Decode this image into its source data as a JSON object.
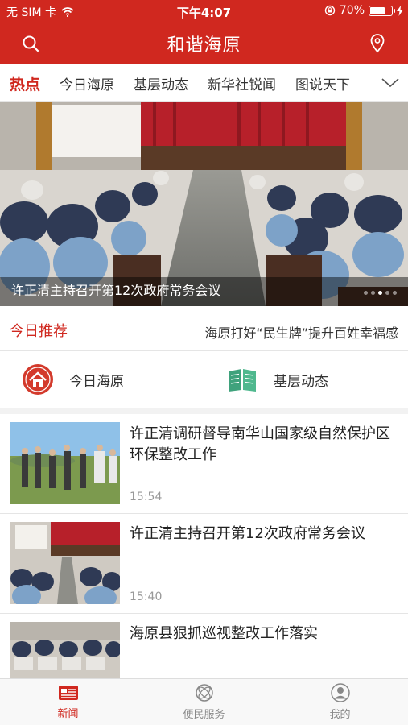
{
  "status_bar": {
    "carrier": "无 SIM 卡",
    "time": "下午4:07",
    "battery": "70%",
    "battery_level": 0.7
  },
  "nav": {
    "title": "和谐海原"
  },
  "channels": {
    "tabs": [
      "热点",
      "今日海原",
      "基层动态",
      "新华社锐闻",
      "图说天下"
    ],
    "active_index": 0
  },
  "hero": {
    "caption": "许正清主持召开第12次政府常务会议",
    "slide_count": 5,
    "active_slide": 2
  },
  "recommend": {
    "label": "今日推荐",
    "headline": "海原打好“民生牌”提升百姓幸福感"
  },
  "quick_links": [
    {
      "label": "今日海原",
      "icon": "house-icon"
    },
    {
      "label": "基层动态",
      "icon": "newspaper-icon"
    }
  ],
  "news": [
    {
      "title": " 许正清调研督导南华山国家级自然保护区环保整改工作",
      "time": "15:54"
    },
    {
      "title": "许正清主持召开第12次政府常务会议",
      "time": "15:40"
    },
    {
      "title": "海原县狠抓巡视整改工作落实",
      "time": ""
    }
  ],
  "tab_bar": {
    "items": [
      {
        "label": "新闻",
        "icon": "newspaper-icon"
      },
      {
        "label": "便民服务",
        "icon": "service-icon"
      },
      {
        "label": "我的",
        "icon": "user-icon"
      }
    ],
    "active_index": 0
  },
  "colors": {
    "brand": "#d0281f",
    "muted": "#999999"
  }
}
